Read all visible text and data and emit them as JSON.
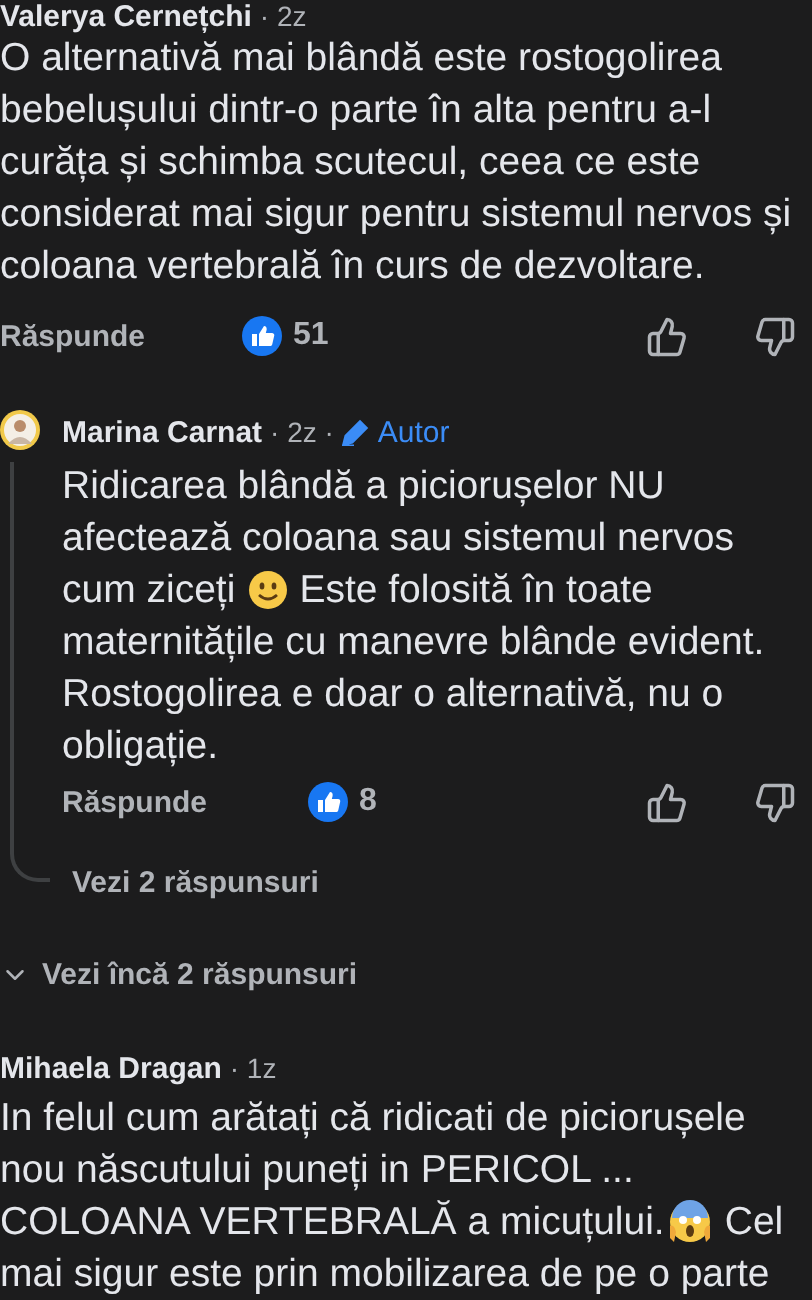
{
  "comments": [
    {
      "author": "Valerya Cernețchi",
      "time": "· 2z",
      "lines": [
        {
          "parts": [
            {
              "kind": "text",
              "text": "O alternativă mai blândă este rostogolirea"
            }
          ]
        },
        {
          "parts": [
            {
              "kind": "text",
              "text": "bebelușului dintr-o parte în alta pentru a-l"
            }
          ]
        },
        {
          "parts": [
            {
              "kind": "text",
              "text": "curăța și schimba scutecul, ceea ce este"
            }
          ]
        },
        {
          "parts": [
            {
              "kind": "text",
              "text": "considerat mai sigur pentru sistemul nervos și"
            }
          ]
        },
        {
          "parts": [
            {
              "kind": "text",
              "text": "coloana vertebrală în curs de dezvoltare."
            }
          ]
        }
      ],
      "reply_label": "Răspunde",
      "likes": "51",
      "replies": [
        {
          "author": "Marina Carnat",
          "time": "· 2z ·",
          "badge": "Autor",
          "lines": [
            {
              "parts": [
                {
                  "kind": "text",
                  "text": "Ridicarea blândă a piciorușelor NU"
                }
              ]
            },
            {
              "parts": [
                {
                  "kind": "text",
                  "text": "afectează coloana sau sistemul nervos"
                }
              ]
            },
            {
              "parts": [
                {
                  "kind": "text",
                  "text": "cum ziceți"
                },
                {
                  "kind": "smile-emoji"
                },
                {
                  "kind": "text",
                  "text": "Este folosită în toate"
                }
              ]
            },
            {
              "parts": [
                {
                  "kind": "text",
                  "text": "maternitățile cu manevre blânde evident."
                }
              ]
            },
            {
              "parts": [
                {
                  "kind": "text",
                  "text": "Rostogolirea e doar o alternativă, nu o"
                }
              ]
            },
            {
              "parts": [
                {
                  "kind": "text",
                  "text": "obligație."
                }
              ]
            }
          ],
          "reply_label": "Răspunde",
          "likes": "8",
          "more_replies": "Vezi 2 răspunsuri"
        }
      ],
      "more_replies": "Vezi încă 2 răspunsuri"
    },
    {
      "author": "Mihaela Dragan",
      "time": "· 1z",
      "lines": [
        {
          "parts": [
            {
              "kind": "text",
              "text": "In felul cum arătați că ridicati de piciorușele"
            }
          ]
        },
        {
          "parts": [
            {
              "kind": "text",
              "text": "nou născutului puneți in PERICOL ..."
            }
          ]
        },
        {
          "parts": [
            {
              "kind": "text",
              "text": "COLOANA VERTEBRALĂ a micuțului."
            },
            {
              "kind": "scream-emoji"
            },
            {
              "kind": "text",
              "text": "Cel"
            }
          ]
        },
        {
          "parts": [
            {
              "kind": "text",
              "text": "mai sigur este prin mobilizarea de pe o parte"
            }
          ]
        }
      ]
    }
  ]
}
